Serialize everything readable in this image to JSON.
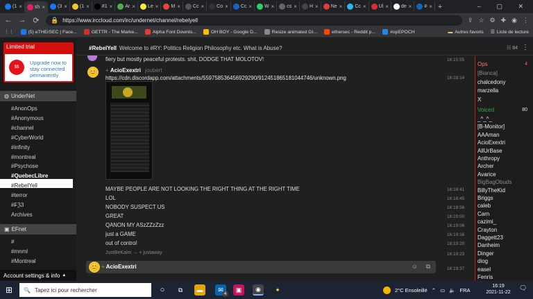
{
  "browser": {
    "tabs": [
      {
        "label": "(1",
        "color": "#1877f2"
      },
      {
        "label": "sh",
        "color": "#e91e63"
      },
      {
        "label": "(3",
        "color": "#1877f2"
      },
      {
        "label": "(1",
        "color": "#f4c430"
      },
      {
        "label": "#1",
        "color": "#000000"
      },
      {
        "label": "Ar",
        "color": "#4caf50"
      },
      {
        "label": "Le",
        "color": "#ffeb3b"
      },
      {
        "label": "M",
        "color": "#ea4335"
      },
      {
        "label": "Cc",
        "color": "#555555"
      },
      {
        "label": "Co",
        "color": "#333333"
      },
      {
        "label": "Cc",
        "color": "#1565c0"
      },
      {
        "label": "W",
        "color": "#25d366"
      },
      {
        "label": "cs",
        "color": "#666666"
      },
      {
        "label": "H",
        "color": "#444444"
      },
      {
        "label": "Ne",
        "color": "#e53935"
      },
      {
        "label": "Cc",
        "color": "#29b6f6"
      },
      {
        "label": "Ul",
        "color": "#d32f2f"
      },
      {
        "label": "de",
        "color": "#ffffff"
      },
      {
        "label": "#",
        "color": "#1565c0"
      }
    ],
    "active_tab_index": 1,
    "url": "https://www.irccloud.com/irc/undernet/channel/rebelyell",
    "bookmarks": [
      {
        "label": "(5) eTHErSEC | Face...",
        "color": "#1877f2"
      },
      {
        "label": "GETTR - The Marke...",
        "color": "#d32f2f"
      },
      {
        "label": "Alpha Font Downlo...",
        "color": "#e53935"
      },
      {
        "label": "OH BOY - Google D...",
        "color": "#fbbc04"
      },
      {
        "label": "Resize animated GI...",
        "color": "#888888"
      },
      {
        "label": "ethersec - Reddit p...",
        "color": "#ff4500"
      },
      {
        "label": "#opEPOCH",
        "color": "#1e88e5"
      }
    ],
    "bookmark_folder": "Autres favoris",
    "reading_list": "Liste de lecture"
  },
  "sidebar": {
    "trial_title": "Limited trial",
    "trial_badge": "$$",
    "trial_link": "Upgrade now to stay connected permanently",
    "networks": [
      {
        "name": "UnderNet",
        "channels": [
          {
            "name": "#AnonOps",
            "bold": false
          },
          {
            "name": "#Anonymous",
            "bold": false
          },
          {
            "name": "#channel",
            "bold": false
          },
          {
            "name": "#CyberWorld",
            "bold": false
          },
          {
            "name": "#infinity",
            "bold": false
          },
          {
            "name": "#montreal",
            "bold": false
          },
          {
            "name": "#Psychose",
            "bold": false
          },
          {
            "name": "#QuebecLibre",
            "bold": true
          },
          {
            "name": "#RebelYell",
            "bold": false,
            "active": true
          },
          {
            "name": "#terror",
            "bold": false
          },
          {
            "name": "#₣ℨ3",
            "bold": false
          },
          {
            "name": "Archives",
            "bold": false
          }
        ]
      },
      {
        "name": "EFnet",
        "channels": [
          {
            "name": "#",
            "bold": false
          },
          {
            "name": "#mnml",
            "bold": false
          },
          {
            "name": "#Montreal",
            "bold": false
          }
        ]
      }
    ],
    "account_label": "Account settings & info"
  },
  "channel": {
    "name": "#RebelYell",
    "topic": "Welcome to #RY: Politics Religion Philosophy etc. What is Abuse?",
    "member_count": "84"
  },
  "messages": [
    {
      "text": "fiery but mostly peaceful protests. shit, DODGE THAT MOLOTOV!",
      "time": "16:15:55"
    },
    {
      "nick": "AcioExextri",
      "user": "joubert",
      "time": "16:18:14"
    },
    {
      "text": "https://cdn.discordapp.com/attachments/559758536456929290/912451865181044746/unknown.png"
    },
    {
      "text": "MAYBE PEOPLE ARE NOT LOOKING THE RIGHT THING AT THE RIGHT TIME",
      "time": "16:18:41"
    },
    {
      "text": "LOL",
      "time": "16:18:45"
    },
    {
      "text": "NOBODY SUSPECT US",
      "time": "16:18:56"
    },
    {
      "text": "GREAT",
      "time": "16:19:00"
    },
    {
      "text": "QANON MY ASzZZzZzz",
      "time": "16:19:06"
    },
    {
      "text": "just a GAME",
      "time": "16:19:16"
    },
    {
      "text": "out of control",
      "time": "16:19:20"
    },
    {
      "text": "JustBeKalm → + justaway",
      "time": "16:19:23"
    }
  ],
  "input": {
    "nick": "AcioExextri",
    "time": "16:19:37"
  },
  "members": {
    "ops_label": "Ops",
    "ops_count": "4",
    "ops": [
      {
        "name": "[Bianca]",
        "dim": true
      },
      {
        "name": "chalcedony",
        "dim": false
      },
      {
        "name": "marzella",
        "dim": false
      },
      {
        "name": "X",
        "dim": false
      }
    ],
    "voiced_label": "Voiced",
    "voiced_count": "80",
    "voiced": [
      {
        "name": "_^_^_",
        "dim": false
      },
      {
        "name": "[B-Monitor]",
        "dim": false
      },
      {
        "name": "AAAman",
        "dim": false
      },
      {
        "name": "AcioExextri",
        "dim": false
      },
      {
        "name": "AllUrBase",
        "dim": false
      },
      {
        "name": "Anthropy",
        "dim": false
      },
      {
        "name": "Archer",
        "dim": false
      },
      {
        "name": "Avarice",
        "dim": false
      },
      {
        "name": "BigBagObuds",
        "dim": true
      },
      {
        "name": "BillyTheKid",
        "dim": false
      },
      {
        "name": "Briggs",
        "dim": false
      },
      {
        "name": "caleb",
        "dim": false
      },
      {
        "name": "Carn",
        "dim": false
      },
      {
        "name": "cazimi_",
        "dim": false
      },
      {
        "name": "Crayton",
        "dim": false
      },
      {
        "name": "Daggett23",
        "dim": false
      },
      {
        "name": "Danheim",
        "dim": false
      },
      {
        "name": "Dinger",
        "dim": false
      },
      {
        "name": "diog",
        "dim": false
      },
      {
        "name": "easel",
        "dim": false
      },
      {
        "name": "Fenris",
        "dim": false
      }
    ]
  },
  "taskbar": {
    "search_placeholder": "Tapez ici pour rechercher",
    "weather": "2°C Ensoleillé",
    "language": "FRA",
    "time": "16:19",
    "date": "2021-11-22",
    "mail_badge": "4"
  },
  "colors": {
    "accent_red": "#d50d0d",
    "link_blue": "#2a78c7",
    "ops_red": "#c21a1a",
    "voiced_green": "#39a845"
  }
}
